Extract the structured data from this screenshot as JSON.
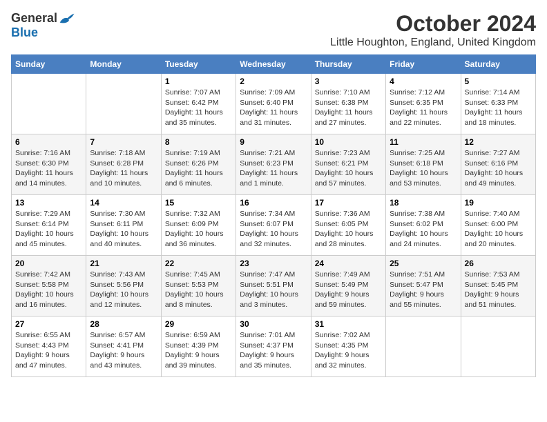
{
  "logo": {
    "general": "General",
    "blue": "Blue"
  },
  "title": "October 2024",
  "location": "Little Houghton, England, United Kingdom",
  "days_of_week": [
    "Sunday",
    "Monday",
    "Tuesday",
    "Wednesday",
    "Thursday",
    "Friday",
    "Saturday"
  ],
  "weeks": [
    [
      {
        "day": "",
        "detail": ""
      },
      {
        "day": "",
        "detail": ""
      },
      {
        "day": "1",
        "detail": "Sunrise: 7:07 AM\nSunset: 6:42 PM\nDaylight: 11 hours and 35 minutes."
      },
      {
        "day": "2",
        "detail": "Sunrise: 7:09 AM\nSunset: 6:40 PM\nDaylight: 11 hours and 31 minutes."
      },
      {
        "day": "3",
        "detail": "Sunrise: 7:10 AM\nSunset: 6:38 PM\nDaylight: 11 hours and 27 minutes."
      },
      {
        "day": "4",
        "detail": "Sunrise: 7:12 AM\nSunset: 6:35 PM\nDaylight: 11 hours and 22 minutes."
      },
      {
        "day": "5",
        "detail": "Sunrise: 7:14 AM\nSunset: 6:33 PM\nDaylight: 11 hours and 18 minutes."
      }
    ],
    [
      {
        "day": "6",
        "detail": "Sunrise: 7:16 AM\nSunset: 6:30 PM\nDaylight: 11 hours and 14 minutes."
      },
      {
        "day": "7",
        "detail": "Sunrise: 7:18 AM\nSunset: 6:28 PM\nDaylight: 11 hours and 10 minutes."
      },
      {
        "day": "8",
        "detail": "Sunrise: 7:19 AM\nSunset: 6:26 PM\nDaylight: 11 hours and 6 minutes."
      },
      {
        "day": "9",
        "detail": "Sunrise: 7:21 AM\nSunset: 6:23 PM\nDaylight: 11 hours and 1 minute."
      },
      {
        "day": "10",
        "detail": "Sunrise: 7:23 AM\nSunset: 6:21 PM\nDaylight: 10 hours and 57 minutes."
      },
      {
        "day": "11",
        "detail": "Sunrise: 7:25 AM\nSunset: 6:18 PM\nDaylight: 10 hours and 53 minutes."
      },
      {
        "day": "12",
        "detail": "Sunrise: 7:27 AM\nSunset: 6:16 PM\nDaylight: 10 hours and 49 minutes."
      }
    ],
    [
      {
        "day": "13",
        "detail": "Sunrise: 7:29 AM\nSunset: 6:14 PM\nDaylight: 10 hours and 45 minutes."
      },
      {
        "day": "14",
        "detail": "Sunrise: 7:30 AM\nSunset: 6:11 PM\nDaylight: 10 hours and 40 minutes."
      },
      {
        "day": "15",
        "detail": "Sunrise: 7:32 AM\nSunset: 6:09 PM\nDaylight: 10 hours and 36 minutes."
      },
      {
        "day": "16",
        "detail": "Sunrise: 7:34 AM\nSunset: 6:07 PM\nDaylight: 10 hours and 32 minutes."
      },
      {
        "day": "17",
        "detail": "Sunrise: 7:36 AM\nSunset: 6:05 PM\nDaylight: 10 hours and 28 minutes."
      },
      {
        "day": "18",
        "detail": "Sunrise: 7:38 AM\nSunset: 6:02 PM\nDaylight: 10 hours and 24 minutes."
      },
      {
        "day": "19",
        "detail": "Sunrise: 7:40 AM\nSunset: 6:00 PM\nDaylight: 10 hours and 20 minutes."
      }
    ],
    [
      {
        "day": "20",
        "detail": "Sunrise: 7:42 AM\nSunset: 5:58 PM\nDaylight: 10 hours and 16 minutes."
      },
      {
        "day": "21",
        "detail": "Sunrise: 7:43 AM\nSunset: 5:56 PM\nDaylight: 10 hours and 12 minutes."
      },
      {
        "day": "22",
        "detail": "Sunrise: 7:45 AM\nSunset: 5:53 PM\nDaylight: 10 hours and 8 minutes."
      },
      {
        "day": "23",
        "detail": "Sunrise: 7:47 AM\nSunset: 5:51 PM\nDaylight: 10 hours and 3 minutes."
      },
      {
        "day": "24",
        "detail": "Sunrise: 7:49 AM\nSunset: 5:49 PM\nDaylight: 9 hours and 59 minutes."
      },
      {
        "day": "25",
        "detail": "Sunrise: 7:51 AM\nSunset: 5:47 PM\nDaylight: 9 hours and 55 minutes."
      },
      {
        "day": "26",
        "detail": "Sunrise: 7:53 AM\nSunset: 5:45 PM\nDaylight: 9 hours and 51 minutes."
      }
    ],
    [
      {
        "day": "27",
        "detail": "Sunrise: 6:55 AM\nSunset: 4:43 PM\nDaylight: 9 hours and 47 minutes."
      },
      {
        "day": "28",
        "detail": "Sunrise: 6:57 AM\nSunset: 4:41 PM\nDaylight: 9 hours and 43 minutes."
      },
      {
        "day": "29",
        "detail": "Sunrise: 6:59 AM\nSunset: 4:39 PM\nDaylight: 9 hours and 39 minutes."
      },
      {
        "day": "30",
        "detail": "Sunrise: 7:01 AM\nSunset: 4:37 PM\nDaylight: 9 hours and 35 minutes."
      },
      {
        "day": "31",
        "detail": "Sunrise: 7:02 AM\nSunset: 4:35 PM\nDaylight: 9 hours and 32 minutes."
      },
      {
        "day": "",
        "detail": ""
      },
      {
        "day": "",
        "detail": ""
      }
    ]
  ]
}
